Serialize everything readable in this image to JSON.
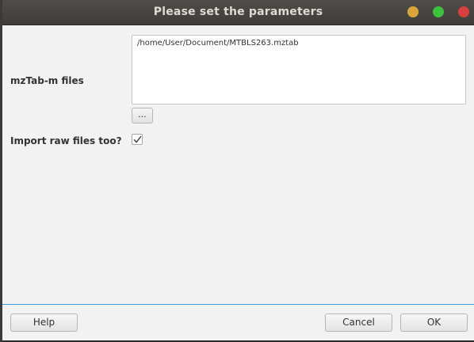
{
  "window": {
    "title": "Please set the parameters",
    "controls": {
      "minimize_color": "#d9a53a",
      "maximize_color": "#3ec23e",
      "close_color": "#d6413f"
    }
  },
  "form": {
    "files_label": "mzTab-m files",
    "files_value": "/home/User/Document/MTBLS263.mztab",
    "browse_label": "...",
    "import_raw_label": "Import raw files too?",
    "import_raw_checked": true
  },
  "footer": {
    "help_label": "Help",
    "cancel_label": "Cancel",
    "ok_label": "OK"
  },
  "colors": {
    "separator_accent": "#3d9ad6"
  }
}
